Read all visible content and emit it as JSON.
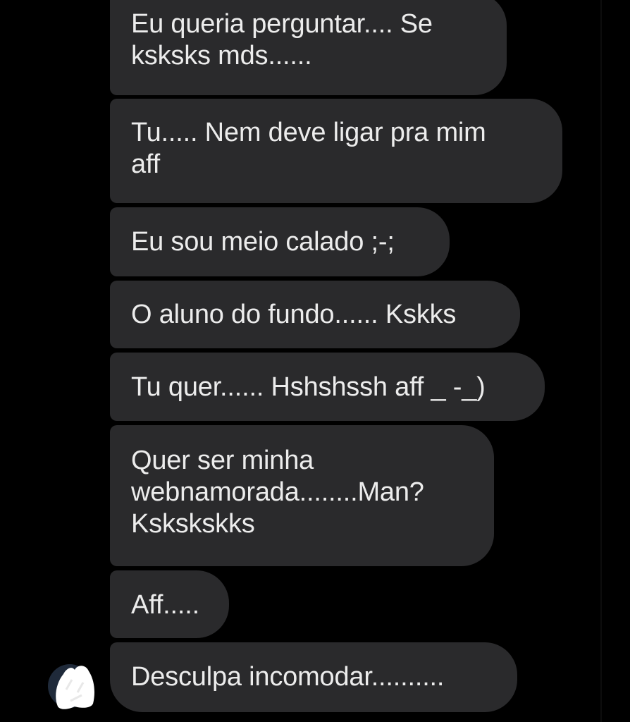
{
  "messages": [
    {
      "text": "Eu queria perguntar.... Se\nksksks mds......"
    },
    {
      "text": "Tu..... Nem deve ligar pra mim\naff"
    },
    {
      "text": "Eu sou meio calado ;-;"
    },
    {
      "text": "O aluno do fundo...... Kskks"
    },
    {
      "text": "Tu quer...... Hshshssh aff _ -_)"
    },
    {
      "text": "Quer ser minha\nwebnamorada........Man?\nKskskskks"
    },
    {
      "text": "Aff....."
    },
    {
      "text": "Desculpa incomodar.........."
    }
  ],
  "colors": {
    "background": "#000000",
    "bubble": "#2a2a2c",
    "text": "#ececec",
    "avatar_cover": "#ffffff"
  },
  "icons": {
    "avatar": "avatar-icon"
  }
}
